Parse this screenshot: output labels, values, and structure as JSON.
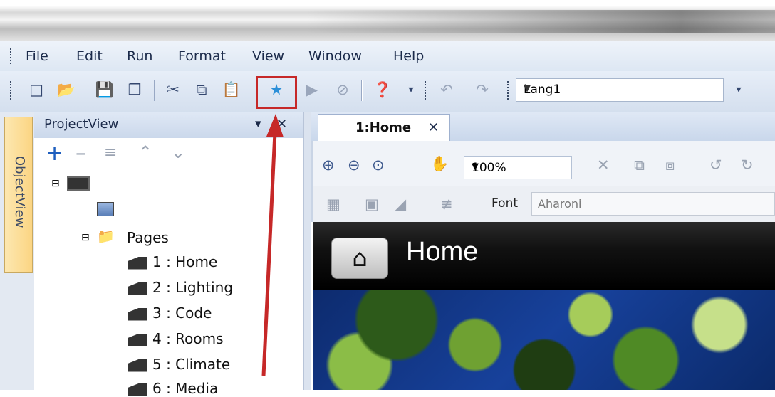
{
  "menu": [
    "File",
    "Edit",
    "Run",
    "Format",
    "View",
    "Window",
    "Help"
  ],
  "toolbar": {
    "language_value": "Lang1"
  },
  "left_strip": {
    "objectview_label": "ObjectView"
  },
  "project_view": {
    "title": "ProjectView",
    "close_glyph": "✕",
    "tree": {
      "pages_label": "Pages",
      "pages": [
        "1 : Home",
        "2 : Lighting",
        "3 : Code",
        "4 : Rooms",
        "5 : Climate",
        "6 : Media"
      ]
    }
  },
  "editor": {
    "tab_label": "1:Home",
    "tab_close": "✕",
    "zoom_value": "100%",
    "font_label": "Font",
    "font_value": "Aharoni"
  },
  "canvas": {
    "page_title": "Home"
  },
  "colors": {
    "highlight": "#c62828",
    "arrow": "#c62828"
  }
}
